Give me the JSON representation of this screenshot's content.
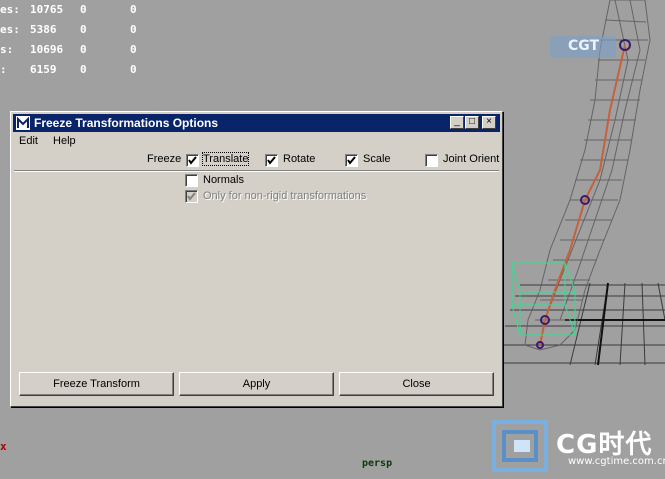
{
  "viewport": {
    "stats": [
      {
        "label": "es:",
        "v1": "10765",
        "v2": "0",
        "v3": "0"
      },
      {
        "label": "es:",
        "v1": "5386",
        "v2": "0",
        "v3": "0"
      },
      {
        "label": "s:",
        "v1": "10696",
        "v2": "0",
        "v3": "0"
      },
      {
        "label": ":",
        "v1": "6159",
        "v2": "0",
        "v3": "0"
      }
    ],
    "camera_label": "persp",
    "axis_label": "x",
    "watermark_brand": "CG时代",
    "watermark_url": "www.cgtime.com.cn",
    "watermark_small": "CGT"
  },
  "dialog": {
    "title": "Freeze Transformations Options",
    "title_buttons": {
      "minimize": "_",
      "maximize": "□",
      "close": "×"
    },
    "menu": [
      "Edit",
      "Help"
    ],
    "freeze_label": "Freeze",
    "options": {
      "translate": {
        "label": "Translate",
        "checked": true
      },
      "rotate": {
        "label": "Rotate",
        "checked": true
      },
      "scale": {
        "label": "Scale",
        "checked": true
      },
      "joint_orient": {
        "label": "Joint Orient",
        "checked": false
      },
      "normals": {
        "label": "Normals",
        "checked": false
      },
      "non_rigid": {
        "label": "Only for non-rigid transformations",
        "checked": true,
        "disabled": true
      }
    },
    "buttons": {
      "freeze": "Freeze Transform",
      "apply": "Apply",
      "close": "Close"
    }
  },
  "colors": {
    "viewport_bg": "#a0a0a0",
    "titlebar": "#0a246a",
    "dialog_bg": "#d4d0c8",
    "wireframe": "#5a5a5a",
    "joint": "#c8603a",
    "selection": "#30e090"
  }
}
